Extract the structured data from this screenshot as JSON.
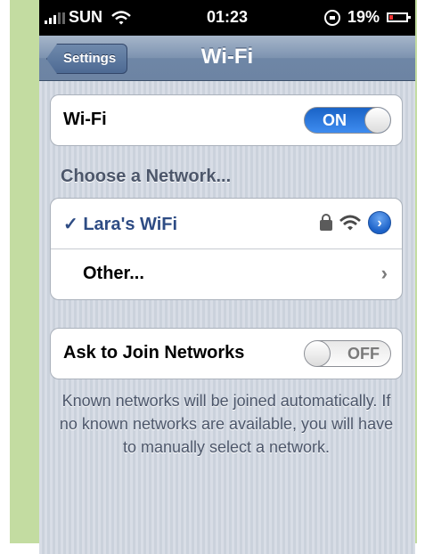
{
  "status_bar": {
    "carrier": "SUN",
    "time": "01:23",
    "battery": "19%"
  },
  "nav": {
    "back_label": "Settings",
    "title": "Wi-Fi"
  },
  "wifi_row": {
    "label": "Wi-Fi",
    "toggle": "ON"
  },
  "networks": {
    "section_title": "Choose a Network...",
    "checkmark": "✓",
    "connected_name": "Lara's WiFi",
    "disclosure": "›",
    "other_label": "Other...",
    "other_chevron": "›"
  },
  "ask_row": {
    "label": "Ask to Join Networks",
    "toggle": "OFF"
  },
  "footer": {
    "text": "Known networks will be joined automatically. If no known networks are available, you will have to manually select a network."
  },
  "colors": {
    "nav_bar": "#7d93b0",
    "toggle_on": "#2a76dd",
    "background": "#cfd6e0",
    "frame": "#c3dca1"
  }
}
